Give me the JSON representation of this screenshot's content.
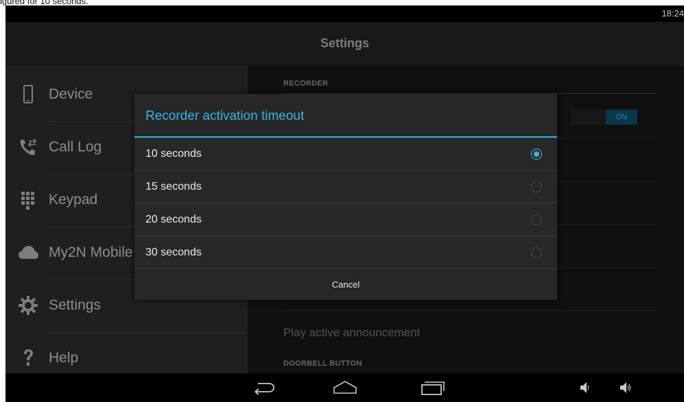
{
  "caption": "igured for 10 seconds.",
  "status_bar": {
    "time": "18:24"
  },
  "action_bar": {
    "title": "Settings"
  },
  "sidebar": {
    "items": [
      {
        "label": "Device",
        "icon": "phone-icon"
      },
      {
        "label": "Call Log",
        "icon": "call-log-icon"
      },
      {
        "label": "Keypad",
        "icon": "keypad-icon"
      },
      {
        "label": "My2N Mobile",
        "icon": "cloud-icon"
      },
      {
        "label": "Settings",
        "icon": "gear-icon"
      },
      {
        "label": "Help",
        "icon": "question-icon"
      }
    ]
  },
  "settings_panel": {
    "recorder_header": "RECORDER",
    "recorder_toggle": "ON",
    "play_announcement": "Play active announcement",
    "doorbell_header": "DOORBELL BUTTON"
  },
  "dialog": {
    "title": "Recorder activation timeout",
    "options": [
      {
        "label": "10 seconds",
        "selected": true
      },
      {
        "label": "15 seconds",
        "selected": false
      },
      {
        "label": "20 seconds",
        "selected": false
      },
      {
        "label": "30 seconds",
        "selected": false
      }
    ],
    "cancel_label": "Cancel"
  },
  "nav_bar": {
    "buttons": [
      "back-icon",
      "home-icon",
      "recent-apps-icon",
      "volume-down-icon",
      "volume-up-icon"
    ]
  },
  "colors": {
    "accent": "#33b5e5",
    "dialog_bg": "#282828",
    "sidebar_bg": "#2a2a2a",
    "actionbar_bg": "#222222"
  }
}
